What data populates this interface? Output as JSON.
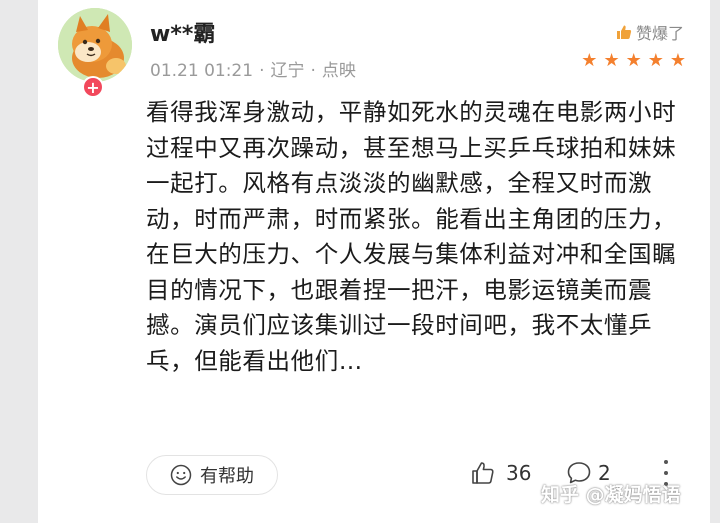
{
  "comment": {
    "username": "w**霸",
    "meta": {
      "time": "01.21 01:21",
      "location": "辽宁",
      "source": "点映",
      "separator": "·"
    },
    "badge": "赞爆了",
    "rating_stars": 5,
    "review_text": "看得我浑身激动，平静如死水的灵魂在电影两小时过程中又再次躁动，甚至想马上买乒乓球拍和妹妹一起打。风格有点淡淡的幽默感，全程又时而激动，时而严肃，时而紧张。能看出主角团的压力，在巨大的压力、个人发展与集体利益对冲和全国瞩目的情况下，也跟着捏一把汗，电影运镜美而震撼。演员们应该集训过一段时间吧，我不太懂乒乓，但能看出他们…",
    "avatar_plus": "+"
  },
  "actions": {
    "helpful_label": "有帮助",
    "like_count": "36",
    "comment_count": "2"
  },
  "watermark": "知乎 @凝妈悟语",
  "colors": {
    "star": "#f4802e",
    "plus_badge": "#f2485c",
    "meta_text": "#9a9a9a"
  },
  "icons": [
    "thumbs-up-icon",
    "star-icon",
    "smile-icon",
    "like-icon",
    "comment-icon",
    "more-icon"
  ]
}
